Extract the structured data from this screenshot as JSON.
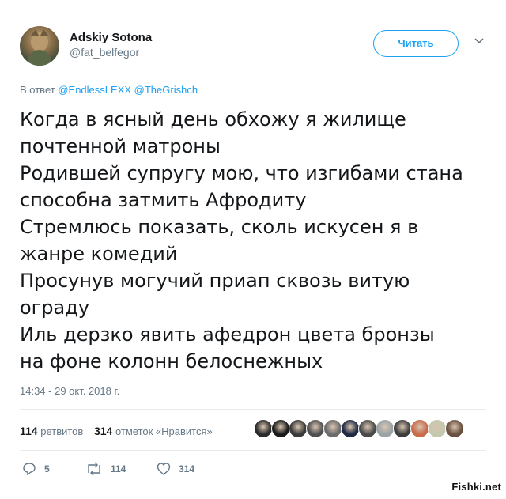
{
  "user": {
    "name": "Adskiy Sotona",
    "handle": "@fat_belfegor"
  },
  "follow_button": {
    "label": "Читать"
  },
  "reply": {
    "prefix": "В ответ",
    "mention1": "@EndlessLEXX",
    "mention2": "@TheGrishch"
  },
  "tweet_lines": [
    "Когда в ясный день обхожу я жилище",
    "почтенной матроны",
    "Родившей супругу мою, что изгибами стана",
    "способна затмить Афродиту",
    "Стремлюсь показать, сколь искусен я в",
    "жанре комедий",
    "Просунув могучий приап сквозь витую",
    "ограду",
    "Иль дерзко явить афедрон цвета бронзы",
    "на фоне колонн белоснежных"
  ],
  "timestamp": "14:34 - 29 окт. 2018 г.",
  "stats": {
    "retweets_count": "114",
    "retweets_label": "ретвитов",
    "likes_count": "314",
    "likes_label": "отметок «Нравится»"
  },
  "liker_avatar_colors": [
    "#2b2b2b",
    "#1a1a1a",
    "#3a3a3a",
    "#505050",
    "#6b6b6b",
    "#1f2a44",
    "#4a4a4a",
    "#9aa3a6",
    "#3d3d3d",
    "#c96a4b",
    "#c4c9ad",
    "#6a5040"
  ],
  "actions": {
    "replies": "5",
    "retweets": "114",
    "likes": "314"
  },
  "watermark": "Fishki.net",
  "colors": {
    "accent": "#1da1f2",
    "secondary_text": "#657786"
  }
}
